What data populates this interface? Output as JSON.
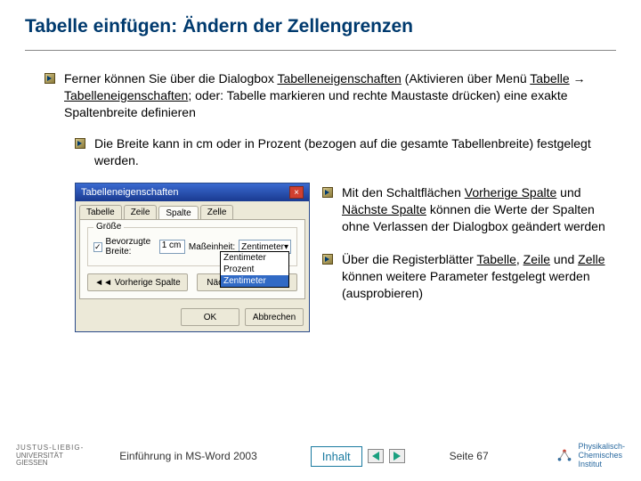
{
  "title": "Tabelle einfügen: Ändern der Zellengrenzen",
  "bullet1": {
    "pre": "Ferner können Sie über die Dialogbox ",
    "u1": "Tabelleneigenschaften",
    "mid1": " (Aktivieren über Menü ",
    "u2": "Tabelle",
    "arrow": " → ",
    "u3": "Tabelleneigenschaften",
    "post": "; oder: Tabelle markieren und rechte Maustaste drücken) eine exakte Spaltenbreite definieren"
  },
  "bullet2": "Die Breite kann in cm oder in Prozent (bezogen auf die gesamte Tabellenbreite) festgelegt werden.",
  "bullet3": {
    "pre": "Mit den Schaltflächen ",
    "u1": "Vorherige Spalte",
    "mid": " und ",
    "u2": "Nächste Spalte",
    "post": " können die Werte der Spalten ohne Verlassen der Dialogbox geändert werden"
  },
  "bullet4": {
    "pre": "Über die Registerblätter ",
    "u1": "Tabelle",
    "c1": ", ",
    "u2": "Zeile",
    "c2": " und ",
    "u3": "Zelle",
    "post": " können weitere Parameter festgelegt werden (ausprobieren)"
  },
  "dialog": {
    "title": "Tabelleneigenschaften",
    "tabs": [
      "Tabelle",
      "Zeile",
      "Spalte",
      "Zelle"
    ],
    "group": "Größe",
    "chk_label": "Bevorzugte Breite:",
    "width_val": "1 cm",
    "unit_label": "Maßeinheit:",
    "unit_sel": "Zentimeter",
    "dd": [
      "Zentimeter",
      "Prozent",
      "Zentimeter"
    ],
    "prev": "◄◄ Vorherige Spalte",
    "next": "Nächste Spalte ►►",
    "ok": "OK",
    "cancel": "Abbrechen"
  },
  "footer": {
    "uni1": "JUSTUS-LIEBIG-",
    "uni2": "UNIVERSITÄT",
    "uni3": "GIESSEN",
    "course": "Einführung in MS-Word 2003",
    "inhalt": "Inhalt",
    "page": "Seite 67",
    "inst1": "Physikalisch-",
    "inst2": "Chemisches",
    "inst3": "Institut"
  }
}
